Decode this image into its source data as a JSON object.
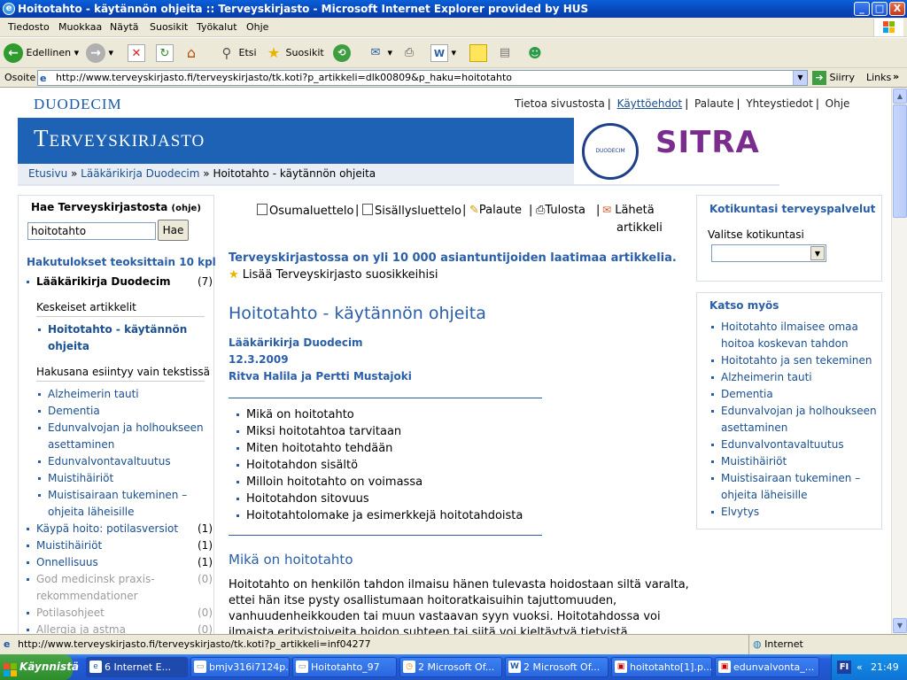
{
  "window": {
    "title": "Hoitotahto - käytännön ohjeita :: Terveyskirjasto - Microsoft Internet Explorer provided by HUS",
    "min": "_",
    "max": "□",
    "close": "X"
  },
  "menu": [
    "Tiedosto",
    "Muokkaa",
    "Näytä",
    "Suosikit",
    "Työkalut",
    "Ohje"
  ],
  "toolbar": {
    "back": "Edellinen",
    "search": "Etsi",
    "favorites": "Suosikit"
  },
  "address": {
    "label": "Osoite",
    "url": "http://www.terveyskirjasto.fi/terveyskirjasto/tk.koti?p_artikkeli=dlk00809&p_haku=hoitotahto",
    "go": "Siirry",
    "links": "Links"
  },
  "site": {
    "logo": "DUODECIM",
    "nav": [
      "Tietoa sivustosta",
      "Käyttöehdot",
      "Palaute",
      "Yhteystiedot",
      "Ohje"
    ],
    "banner_title": "Terveyskirjasto",
    "seal_text": "DUODECIM",
    "sitra": "SITRA",
    "breadcrumb": [
      "Etusivu",
      "Lääkärikirja Duodecim",
      "Hoitotahto - käytännön ohjeita"
    ]
  },
  "left": {
    "search_heading": "Hae Terveyskirjastosta",
    "help": "(ohje)",
    "search_value": "hoitotahto",
    "search_button": "Hae",
    "results_heading": "Hakutulokset teoksittain 10 kpl",
    "book": "Lääkärikirja Duodecim",
    "book_count": "(7)",
    "key_heading": "Keskeiset artikkelit",
    "key_items": [
      "Hoitotahto - käytännön",
      "ohjeita"
    ],
    "text_heading": "Hakusana esiintyy vain tekstissä",
    "text_items": [
      "Alzheimerin tauti",
      "Dementia",
      "Edunvalvojan ja holhoukseen",
      "asettaminen",
      "Edunvalvontavaltuutus",
      "Muistihäiriöt",
      "Muistisairaan tukeminen –",
      "ohjeita läheisille"
    ],
    "other": [
      {
        "label": "Käypä hoito: potilasversiot",
        "count": "(1)"
      },
      {
        "label": "Muistihäiriöt",
        "count": "(1)"
      },
      {
        "label": "Onnellisuus",
        "count": "(1)"
      },
      {
        "label": "God medicinsk praxis-",
        "count": "(0)"
      },
      {
        "label": "rekommendationer",
        "count": ""
      },
      {
        "label": "Potilasohjeet",
        "count": "(0)"
      },
      {
        "label": "Allergia ja astma",
        "count": "(0)"
      }
    ]
  },
  "mid": {
    "tools": [
      "Osumaluettelo",
      "Sisällysluettelo",
      "Palaute",
      "Tulosta",
      "Lähetä",
      "artikkeli"
    ],
    "sep": "|",
    "tagline": "Terveyskirjastossa on yli 10 000 asiantuntijoiden laatimaa artikkelia.",
    "favorite": "Lisää Terveyskirjasto suosikkeihisi",
    "title": "Hoitotahto - käytännön ohjeita",
    "source": "Lääkärikirja Duodecim",
    "date": "12.3.2009",
    "authors": "Ritva Halila ja Pertti Mustajoki",
    "toc": [
      "Mikä on hoitotahto",
      "Miksi hoitotahtoa tarvitaan",
      "Miten hoitotahto tehdään",
      "Hoitotahdon sisältö",
      "Milloin hoitotahto on voimassa",
      "Hoitotahdon sitovuus",
      "Hoitotahtolomake ja esimerkkejä hoitotahdoista"
    ],
    "section": "Mikä on hoitotahto",
    "body": [
      "Hoitotahto on henkilön tahdon ilmaisu hänen tulevasta hoidostaan siltä varalta,",
      "ettei hän itse pysty osallistumaan hoitoratkaisuihin tajuttomuuden,",
      "vanhuudenheikkouden tai muun vastaavan syyn vuoksi. Hoitotahdossa voi",
      "ilmaista erityistoiveita hoidon suhteen tai siitä voi kieltäytyä tietyistä"
    ]
  },
  "right": {
    "box1_heading": "Kotikuntasi terveyspalvelut",
    "box1_label": "Valitse kotikuntasi",
    "box2_heading": "Katso myös",
    "links": [
      "Hoitotahto ilmaisee omaa",
      "hoitoa koskevan tahdon",
      "Hoitotahto ja sen tekeminen",
      "Alzheimerin tauti",
      "Dementia",
      "Edunvalvojan ja holhoukseen",
      "asettaminen",
      "Edunvalvontavaltuutus",
      "Muistihäiriöt",
      "Muistisairaan tukeminen –",
      "ohjeita läheisille",
      "Elvytys"
    ]
  },
  "status": {
    "url": "http://www.terveyskirjasto.fi/terveyskirjasto/tk.koti?p_artikkeli=inf04277",
    "zone": "Internet"
  },
  "taskbar": {
    "start": "Käynnistä",
    "tasks": [
      "6 Internet E...",
      "bmjv316i7124p...",
      "Hoitotahto_97",
      "2 Microsoft Of...",
      "2 Microsoft Of...",
      "hoitotahto[1].p...",
      "edunvalvonta_..."
    ],
    "lang": "FI",
    "clock": "21:49"
  },
  "colors": {
    "link": "#1b4f8f",
    "banner": "#1d62b4",
    "heading": "#2a5ea8",
    "sitra": "#7b2d8e"
  }
}
